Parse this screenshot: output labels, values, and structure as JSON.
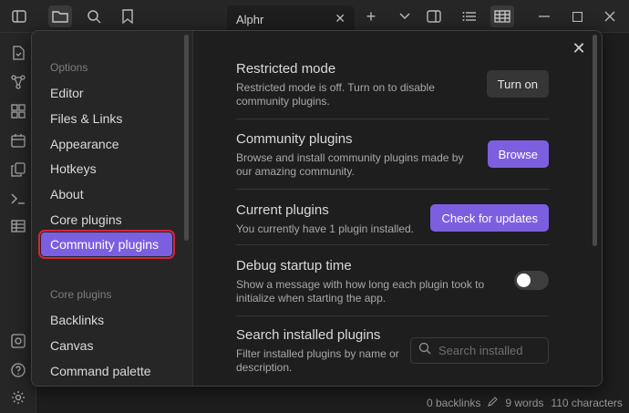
{
  "tab": {
    "title": "Alphr",
    "close": "✕"
  },
  "toolbar": {
    "new_tab": "+"
  },
  "modal": {
    "close": "✕",
    "sidebar": {
      "options_heading": "Options",
      "options": [
        "Editor",
        "Files & Links",
        "Appearance",
        "Hotkeys",
        "About",
        "Core plugins",
        "Community plugins"
      ],
      "core_heading": "Core plugins",
      "core": [
        "Backlinks",
        "Canvas",
        "Command palette"
      ],
      "selected": "Community plugins"
    },
    "settings": [
      {
        "name": "Restricted mode",
        "desc": "Restricted mode is off. Turn on to disable community plugins.",
        "control": "button",
        "label": "Turn on",
        "style": "normal"
      },
      {
        "name": "Community plugins",
        "desc": "Browse and install community plugins made by our amazing community.",
        "control": "button",
        "label": "Browse",
        "style": "accent"
      },
      {
        "name": "Current plugins",
        "desc": "You currently have 1 plugin installed.",
        "control": "button",
        "label": "Check for updates",
        "style": "accent"
      },
      {
        "name": "Debug startup time",
        "desc": "Show a message with how long each plugin took to initialize when starting the app.",
        "control": "toggle",
        "checked": false
      },
      {
        "name": "Search installed plugins",
        "desc": "Filter installed plugins by name or description.",
        "control": "search",
        "placeholder": "Search installed"
      }
    ]
  },
  "status": {
    "backlinks": "0 backlinks",
    "words": "9 words",
    "characters": "110 characters"
  },
  "colors": {
    "accent": "#7c5fe0",
    "highlight": "#d6243a"
  }
}
